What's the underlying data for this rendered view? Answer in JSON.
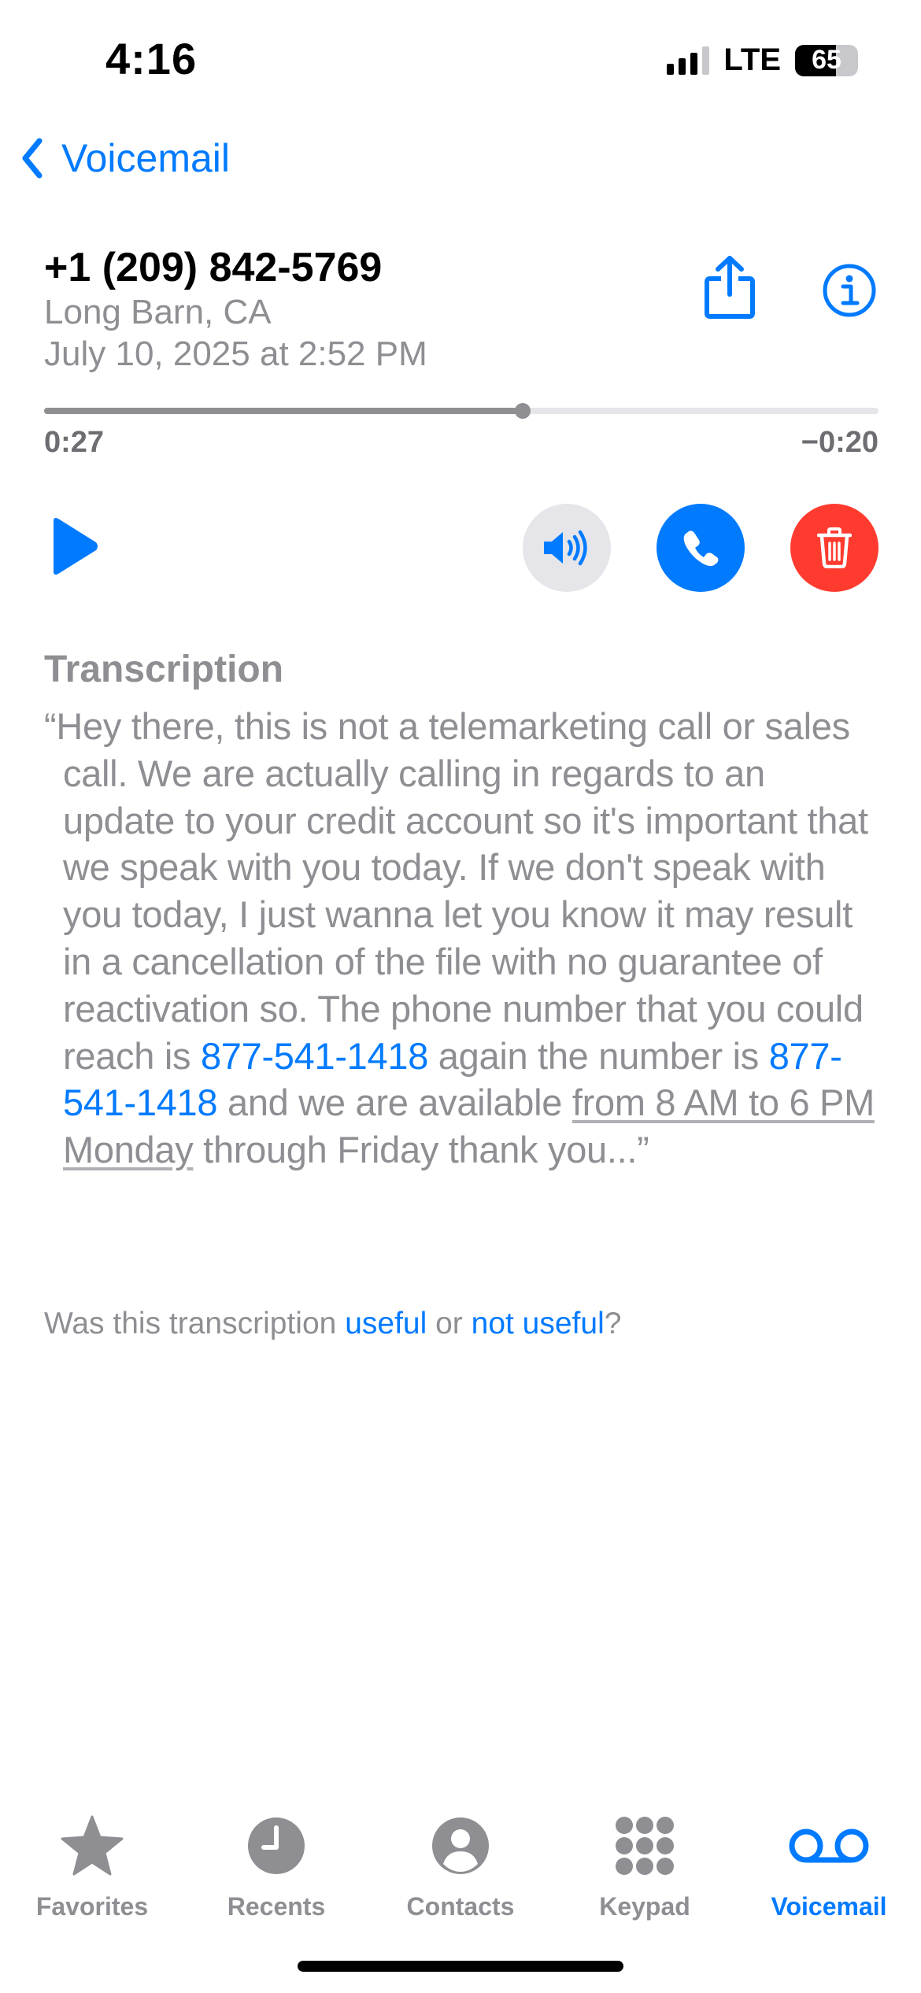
{
  "status_bar": {
    "time": "4:16",
    "network": "LTE",
    "battery": "65",
    "battery_level": 0.65
  },
  "nav": {
    "back_label": "Voicemail",
    "back_icon": "chevron-left-icon"
  },
  "voicemail": {
    "caller_number": "+1 (209) 842-5769",
    "location": "Long Barn, CA",
    "date": "July 10, 2025 at 2:52 PM",
    "elapsed": "0:27",
    "remaining": "−0:20",
    "progress": 0.574
  },
  "controls": {
    "play_icon": "play-icon",
    "speaker_icon": "speaker-icon",
    "call_icon": "phone-icon",
    "delete_icon": "trash-icon",
    "share_icon": "share-icon",
    "info_icon": "info-icon"
  },
  "transcription": {
    "heading": "Transcription",
    "part1": "“Hey there, this is not a telemarketing call or sales call. We are actually calling in regards to an update to your credit account so it's important that we speak with you today. If we don't speak with you today, I just wanna let you know it may result in a cancellation of the file with no guarantee of reactivation so. The phone number that you could reach is ",
    "phone1": "877-541-1418",
    "part2": " again the number is ",
    "phone2": "877-541-1418",
    "part3": " and we are available ",
    "hours": "from 8 AM to 6 PM Monday",
    "part4": " through Friday thank you...”"
  },
  "feedback": {
    "prefix": "Was this transcription ",
    "useful": "useful",
    "middle": " or ",
    "not_useful": "not useful",
    "suffix": "?"
  },
  "tabs": [
    {
      "label": "Favorites",
      "icon": "star-icon"
    },
    {
      "label": "Recents",
      "icon": "clock-icon"
    },
    {
      "label": "Contacts",
      "icon": "person-icon"
    },
    {
      "label": "Keypad",
      "icon": "keypad-icon"
    },
    {
      "label": "Voicemail",
      "icon": "voicemail-icon",
      "active": true
    }
  ],
  "colors": {
    "accent": "#007aff",
    "delete": "#ff3b30",
    "secondary_text": "#8e8e93"
  }
}
